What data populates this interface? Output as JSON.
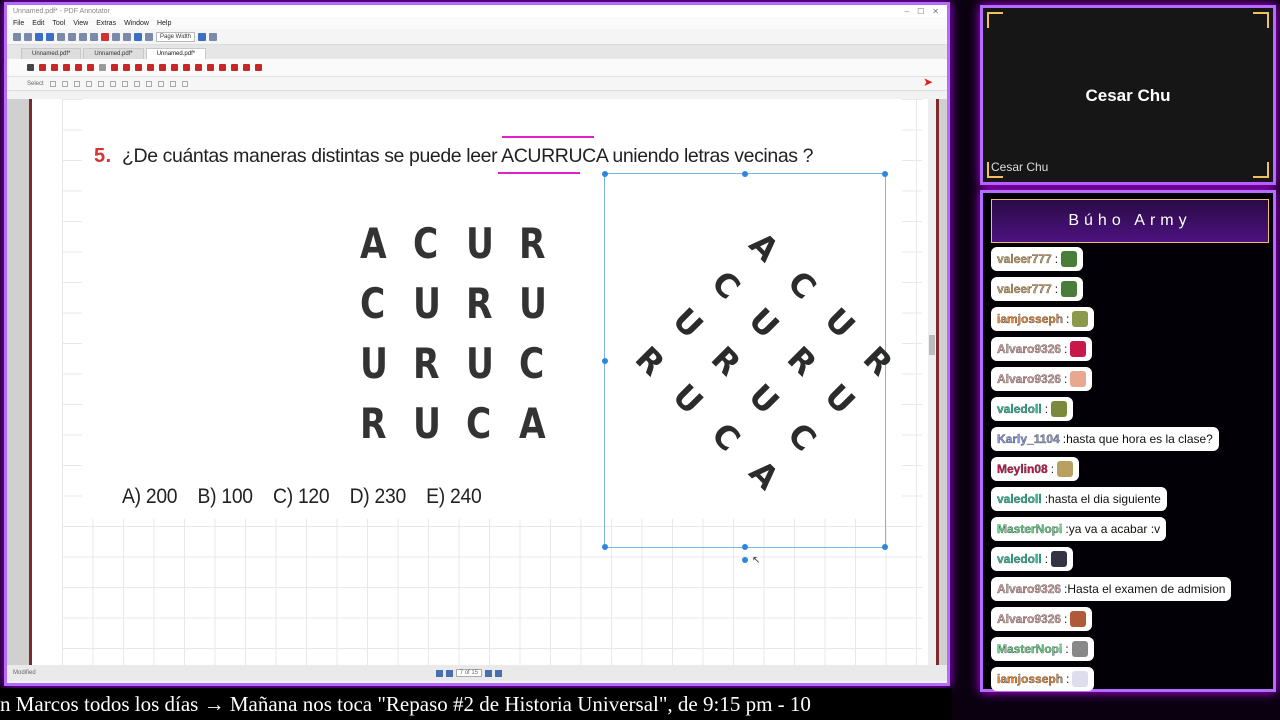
{
  "app": {
    "title": "Unnamed.pdf* - PDF Annotator",
    "menu": [
      "File",
      "Edit",
      "Tool",
      "View",
      "Extras",
      "Window",
      "Help"
    ],
    "zoom_label": "Page Width",
    "tabs": [
      "Unnamed.pdf*",
      "Unnamed.pdf*",
      "Unnamed.pdf*"
    ],
    "active_tab": 2,
    "select_label": "Select",
    "status_left": "Modified",
    "page_indicator": "7 of 15"
  },
  "question": {
    "number": "5.",
    "text": "¿De cuántas maneras distintas se puede leer ACURRUCA uniendo letras vecinas  ?",
    "grid": [
      [
        "A",
        "C",
        "U",
        "R"
      ],
      [
        "C",
        "U",
        "R",
        "U"
      ],
      [
        "U",
        "R",
        "U",
        "C"
      ],
      [
        "R",
        "U",
        "C",
        "A"
      ]
    ],
    "answers": [
      "A)  200",
      "B)  100",
      "C)  120",
      "D)  230",
      "E)  240"
    ]
  },
  "webcam": {
    "name": "Cesar Chu",
    "label": "Cesar Chu"
  },
  "chat": {
    "title": "Búho Army",
    "messages": [
      {
        "user": "valeer777",
        "color": "#c9a46a",
        "text": "",
        "emote": "#4a7d3a"
      },
      {
        "user": "valeer777",
        "color": "#c9a46a",
        "text": "",
        "emote": "#4a7d3a"
      },
      {
        "user": "iamjosseph",
        "color": "#e0893a",
        "text": "",
        "emote": "#8a9a4a"
      },
      {
        "user": "Alvaro9326",
        "color": "#d4a0a0",
        "text": "",
        "emote": "#c8184a"
      },
      {
        "user": "Alvaro9326",
        "color": "#d4a0a0",
        "text": "",
        "emote": "#e8a890"
      },
      {
        "user": "valedoll",
        "color": "#2fbf9a",
        "text": "",
        "emote": "#7a8a3a"
      },
      {
        "user": "Karly_1104",
        "color": "#8a9ad8",
        "text": "hasta que hora es la clase?",
        "emote": ""
      },
      {
        "user": "Meylin08",
        "color": "#c8184a",
        "text": "",
        "emote": "#b8a060"
      },
      {
        "user": "valedoll",
        "color": "#2fbf9a",
        "text": "hasta el dia siguiente",
        "emote": ""
      },
      {
        "user": "MasterNopi",
        "color": "#6ad48a",
        "text": "ya va a acabar :v",
        "emote": ""
      },
      {
        "user": "valedoll",
        "color": "#2fbf9a",
        "text": "",
        "emote": "#333344"
      },
      {
        "user": "Alvaro9326",
        "color": "#d4a0a0",
        "text": "Hasta el examen de admision",
        "emote": ""
      },
      {
        "user": "Alvaro9326",
        "color": "#d4a0a0",
        "text": "",
        "emote": "#b05a3a"
      },
      {
        "user": "MasterNopi",
        "color": "#6ad48a",
        "text": "",
        "emote": "#888"
      },
      {
        "user": "iamjosseph",
        "color": "#e0893a",
        "text": "",
        "emote": "#dde"
      }
    ]
  },
  "ticker": "n Marcos todos los días  →  Mañana nos toca \"Repaso #2 de Historia Universal\", de 9:15 pm - 10"
}
